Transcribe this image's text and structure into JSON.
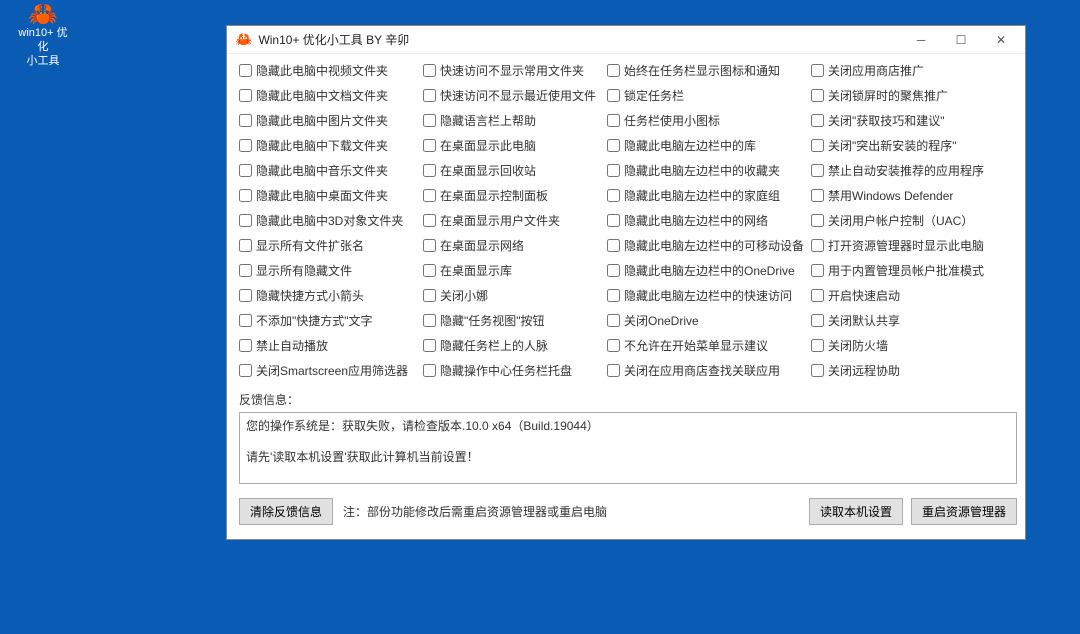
{
  "desktop": {
    "icon_label": "win10+ 优化\n小工具"
  },
  "titlebar": {
    "title": "Win10+ 优化小工具 BY 辛卯"
  },
  "checkboxes": [
    [
      "隐藏此电脑中视频文件夹",
      "快速访问不显示常用文件夹",
      "始终在任务栏显示图标和通知",
      "关闭应用商店推广"
    ],
    [
      "隐藏此电脑中文档文件夹",
      "快速访问不显示最近使用文件",
      "锁定任务栏",
      "关闭锁屏时的聚焦推广"
    ],
    [
      "隐藏此电脑中图片文件夹",
      "隐藏语言栏上帮助",
      "任务栏使用小图标",
      "关闭\"获取技巧和建议\""
    ],
    [
      "隐藏此电脑中下载文件夹",
      "在桌面显示此电脑",
      "隐藏此电脑左边栏中的库",
      "关闭\"突出新安装的程序\""
    ],
    [
      "隐藏此电脑中音乐文件夹",
      "在桌面显示回收站",
      "隐藏此电脑左边栏中的收藏夹",
      "禁止自动安装推荐的应用程序"
    ],
    [
      "隐藏此电脑中桌面文件夹",
      "在桌面显示控制面板",
      "隐藏此电脑左边栏中的家庭组",
      "禁用Windows Defender"
    ],
    [
      "隐藏此电脑中3D对象文件夹",
      "在桌面显示用户文件夹",
      "隐藏此电脑左边栏中的网络",
      "关闭用户帐户控制（UAC）"
    ],
    [
      "显示所有文件扩张名",
      "在桌面显示网络",
      "隐藏此电脑左边栏中的可移动设备",
      "打开资源管理器时显示此电脑"
    ],
    [
      "显示所有隐藏文件",
      "在桌面显示库",
      "隐藏此电脑左边栏中的OneDrive",
      "用于内置管理员帐户批准模式"
    ],
    [
      "隐藏快捷方式小箭头",
      "关闭小娜",
      "隐藏此电脑左边栏中的快速访问",
      "开启快速启动"
    ],
    [
      "不添加\"快捷方式\"文字",
      "隐藏\"任务视图\"按钮",
      "关闭OneDrive",
      "关闭默认共享"
    ],
    [
      "禁止自动播放",
      "隐藏任务栏上的人脉",
      "不允许在开始菜单显示建议",
      "关闭防火墙"
    ],
    [
      "关闭Smartscreen应用筛选器",
      "隐藏操作中心任务栏托盘",
      "关闭在应用商店查找关联应用",
      "关闭远程协助"
    ]
  ],
  "feedback": {
    "label": "反馈信息：",
    "text": "您的操作系统是：获取失败，请检查版本.10.0  x64（Build.19044）\n\n请先'读取本机设置'获取此计算机当前设置！"
  },
  "footer": {
    "clear_btn": "清除反馈信息",
    "note": "注：部份功能修改后需重启资源管理器或重启电脑",
    "read_btn": "读取本机设置",
    "restart_btn": "重启资源管理器"
  }
}
